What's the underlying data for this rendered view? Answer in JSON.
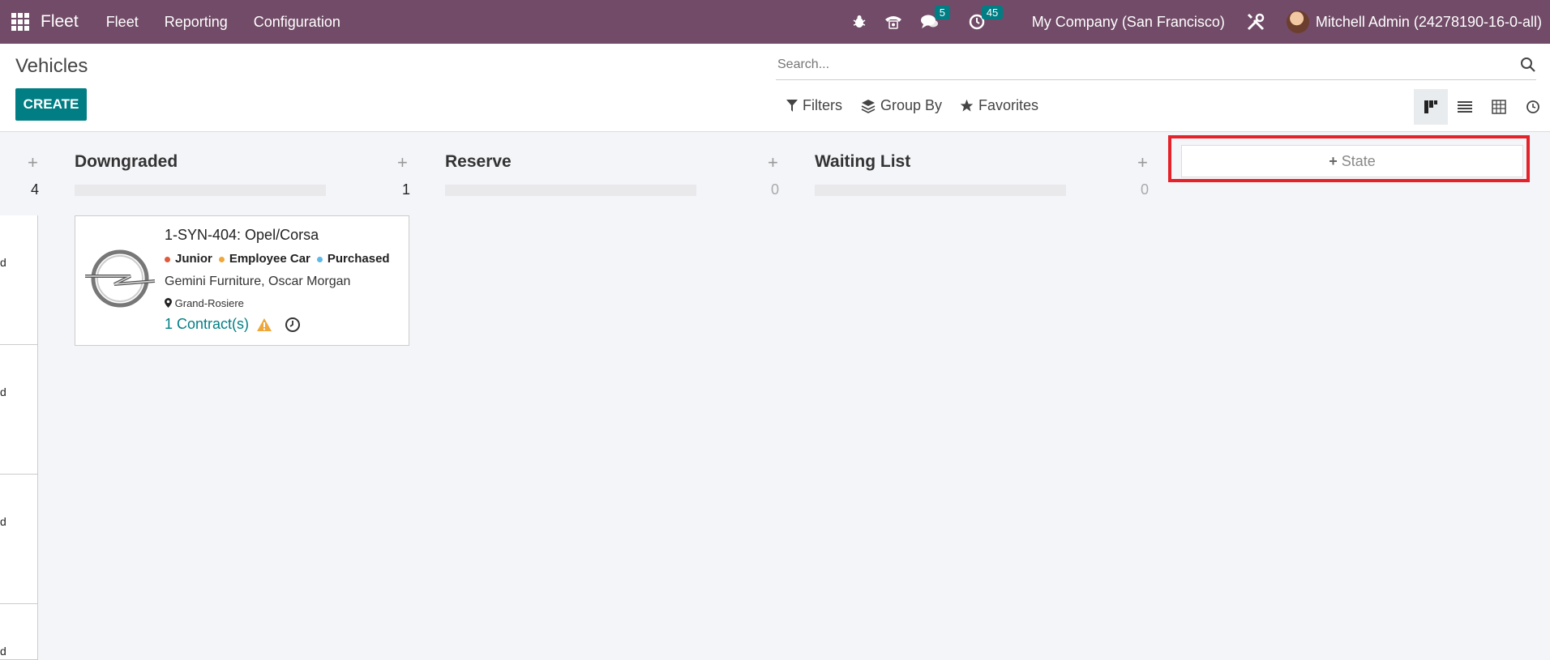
{
  "topbar": {
    "brand": "Fleet",
    "menu": [
      "Fleet",
      "Reporting",
      "Configuration"
    ],
    "chat_badge": "5",
    "activity_badge": "45",
    "company": "My Company (San Francisco)",
    "user": "Mitchell Admin (24278190-16-0-all)"
  },
  "control_panel": {
    "title": "Vehicles",
    "create_label": "CREATE",
    "search_placeholder": "Search...",
    "filters_label": "Filters",
    "groupby_label": "Group By",
    "favorites_label": "Favorites"
  },
  "kanban": {
    "first_column_count": "4",
    "left_card_fragments": [
      "d",
      "d",
      "d",
      "d"
    ],
    "columns": [
      {
        "title": "Downgraded",
        "count": "1"
      },
      {
        "title": "Reserve",
        "count": "0"
      },
      {
        "title": "Waiting List",
        "count": "0"
      }
    ],
    "card": {
      "name": "1-SYN-404: Opel/Corsa",
      "tags": [
        {
          "label": "Junior",
          "color": "#e05a3a"
        },
        {
          "label": "Employee Car",
          "color": "#f0a73a"
        },
        {
          "label": "Purchased",
          "color": "#5fb8e8"
        }
      ],
      "driver": "Gemini Furniture, Oscar Morgan",
      "location": "Grand-Rosiere",
      "contracts": "1 Contract(s)"
    },
    "add_state_label": "State"
  },
  "colors": {
    "topbar": "#714b67",
    "primary": "#017e84",
    "highlight": "#e52229"
  }
}
